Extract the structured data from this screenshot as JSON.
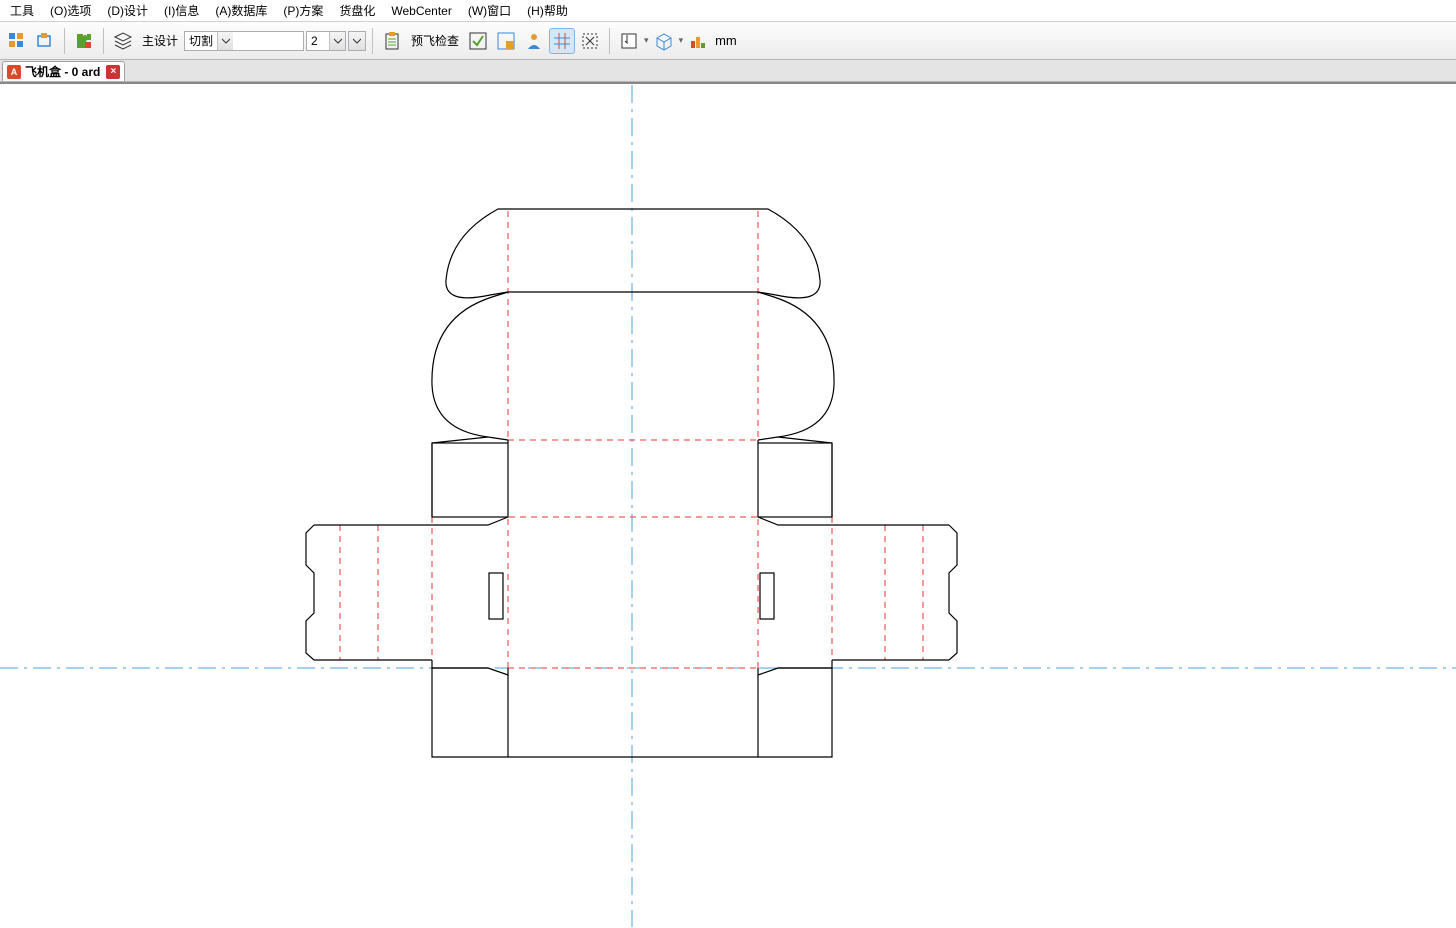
{
  "menu": {
    "items": [
      "工具",
      "(O)选项",
      "(D)设计",
      "(I)信息",
      "(A)数据库",
      "(P)方案",
      "货盘化",
      "WebCenter",
      "(W)窗口",
      "(H)帮助"
    ]
  },
  "toolbar": {
    "main_design_label": "主设计",
    "layer_select": "切割",
    "num_value": "2",
    "preflight_label": "预飞检查",
    "unit_label": "mm"
  },
  "tab": {
    "title": "飞机盒 - 0 ard"
  }
}
